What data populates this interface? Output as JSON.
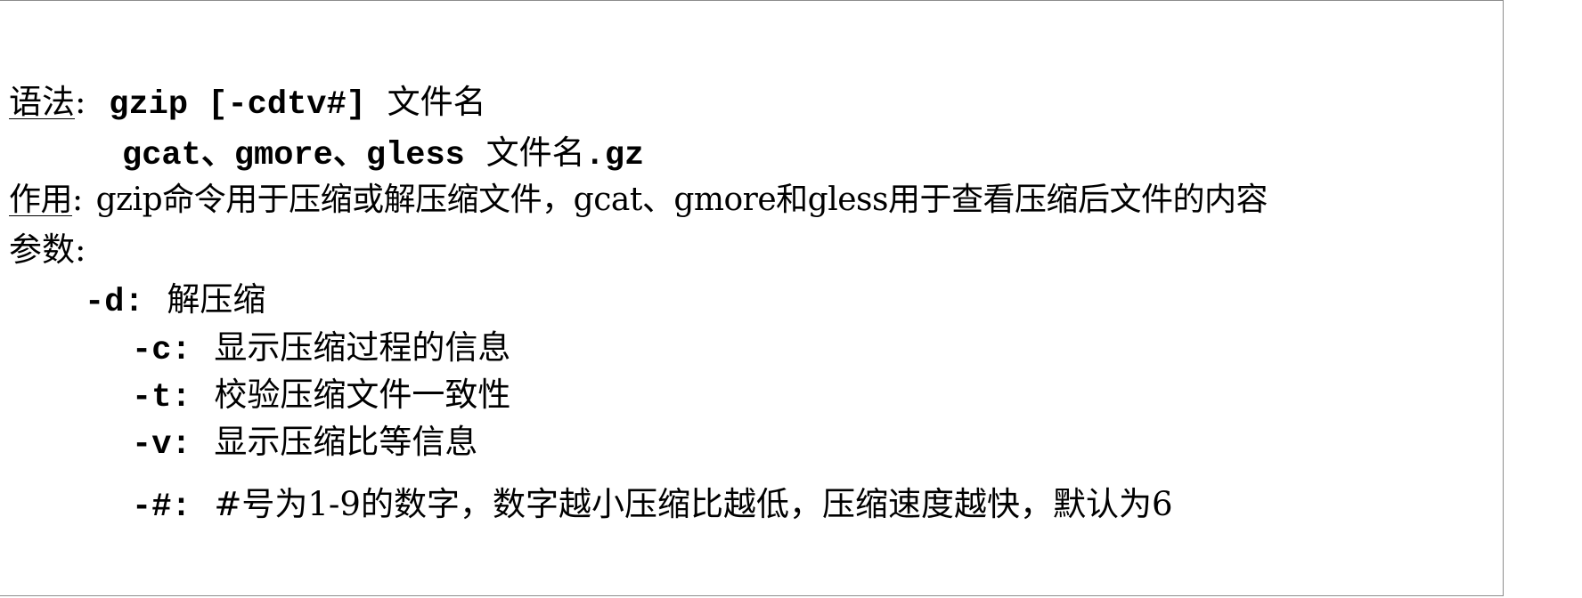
{
  "syntax": {
    "label": "语法",
    "colon": ":",
    "cmd1": "gzip [-cdtv#]",
    "arg1": "文件名",
    "cmd2": "gcat、gmore、gless",
    "arg2": "文件名",
    "ext2": ".gz"
  },
  "purpose": {
    "label": "作用",
    "colon": ":",
    "text": "gzip命令用于压缩或解压缩文件，gcat、gmore和gless用于查看压缩后文件的内容"
  },
  "params": {
    "label": "参数:",
    "items": [
      {
        "flag": "-d:",
        "desc": "解压缩"
      },
      {
        "flag": "-c:",
        "desc": "显示压缩过程的信息"
      },
      {
        "flag": "-t:",
        "desc": "校验压缩文件一致性"
      },
      {
        "flag": "-v:",
        "desc": "显示压缩比等信息"
      },
      {
        "flag": "-#:",
        "desc": "#号为1-9的数字，数字越小压缩比越低，压缩速度越快，默认为6"
      }
    ]
  }
}
